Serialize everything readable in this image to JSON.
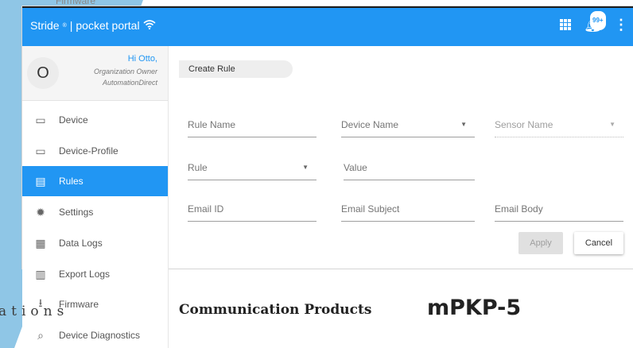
{
  "app": {
    "brand": "Stride",
    "brand_sep": "|",
    "product": "pocket portal",
    "badge_count": "99+",
    "colors": {
      "primary": "#2196f3"
    }
  },
  "user": {
    "avatar_initial": "O",
    "greeting": "Hi Otto,",
    "role": "Organization Owner",
    "org": "AutomationDirect"
  },
  "top_partial_label": "Firmware",
  "sidebar": {
    "items": [
      {
        "label": "Device",
        "icon": "device-icon"
      },
      {
        "label": "Device-Profile",
        "icon": "device-profile-icon"
      },
      {
        "label": "Rules",
        "icon": "rules-icon",
        "active": true
      },
      {
        "label": "Settings",
        "icon": "gear-icon"
      },
      {
        "label": "Data Logs",
        "icon": "data-logs-icon"
      },
      {
        "label": "Export Logs",
        "icon": "export-logs-icon"
      },
      {
        "label": "Firmware",
        "icon": "firmware-icon"
      },
      {
        "label": "Device Diagnostics",
        "icon": "diagnostics-icon"
      }
    ]
  },
  "main": {
    "create_rule": "Create Rule",
    "fields": {
      "rule_name": "Rule Name",
      "device_name": "Device Name",
      "sensor_name": "Sensor Name",
      "rule": "Rule",
      "value": "Value",
      "email_id": "Email ID",
      "email_subject": "Email Subject",
      "email_body": "Email Body"
    },
    "apply": "Apply",
    "cancel": "Cancel"
  },
  "document": {
    "side_text": "ations",
    "caption": "Communication Products",
    "model": "mPKP-5"
  }
}
